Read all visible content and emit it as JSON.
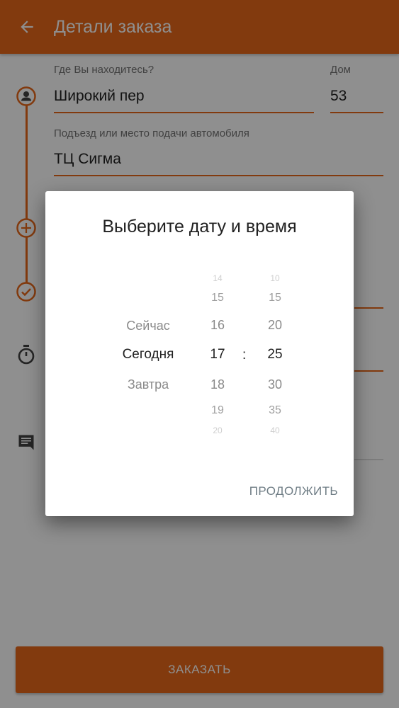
{
  "header": {
    "title": "Детали заказа",
    "back_icon": "arrow-back-icon"
  },
  "form": {
    "street_label": "Где Вы находитесь?",
    "street_value": "Широкий пер",
    "house_label": "Дом",
    "house_value": "53",
    "entrance_label": "Подъезд или место подачи автомобиля",
    "entrance_value": "ТЦ Сигма"
  },
  "timeline_icons": [
    "person-icon",
    "add-icon",
    "check-icon",
    "stopwatch-icon",
    "comment-icon"
  ],
  "order_button": "ЗАКАЗАТЬ",
  "dialog": {
    "title": "Выберите дату и время",
    "days": [
      "Сейчас",
      "Сегодня",
      "Завтра"
    ],
    "selected_day": "Сегодня",
    "hours": [
      "14",
      "15",
      "16",
      "17",
      "18",
      "19",
      "20"
    ],
    "selected_hour": "17",
    "minutes": [
      "10",
      "15",
      "20",
      "25",
      "30",
      "35",
      "40"
    ],
    "selected_minute": "25",
    "separator": ":",
    "continue_label": "ПРОДОЛЖИТЬ"
  },
  "colors": {
    "accent": "#e8681a",
    "scrim": "rgba(0,0,0,0.44)",
    "dialog_button": "#6f7d85"
  }
}
